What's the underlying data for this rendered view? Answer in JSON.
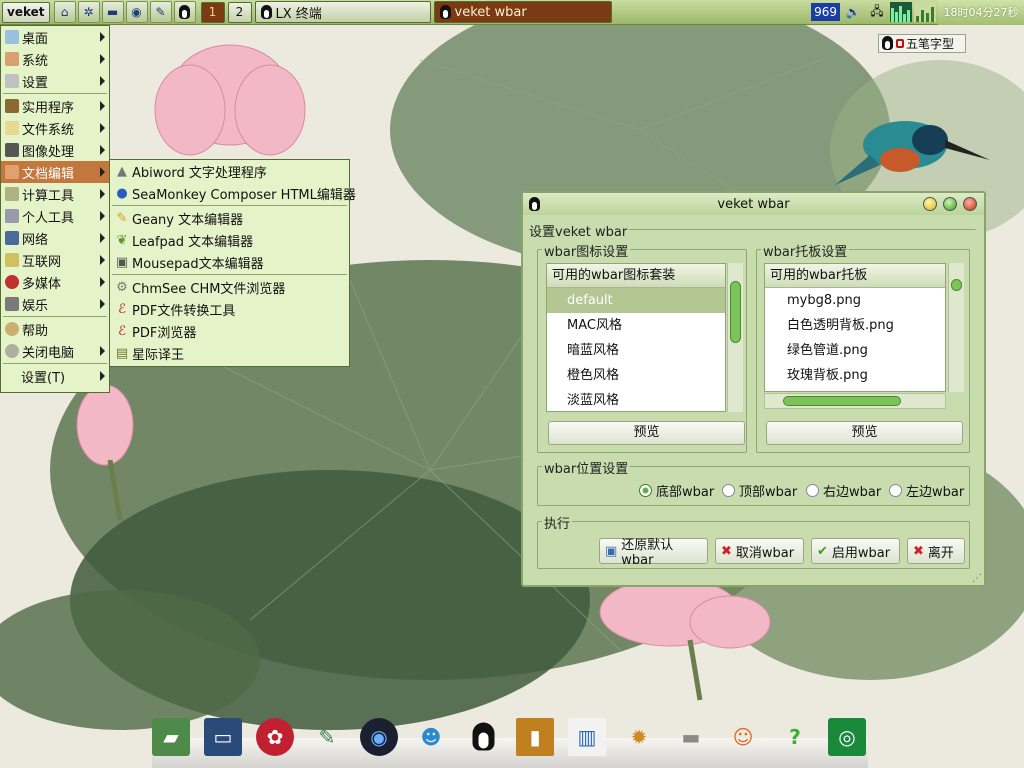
{
  "taskbar": {
    "start_label": "veket",
    "quicklaunch_icons": [
      "home-icon",
      "settings-icon",
      "terminal-icon",
      "browser-icon",
      "tools-icon",
      "qq-icon"
    ],
    "desktops": [
      "1",
      "2"
    ],
    "tasks": [
      {
        "label": "LX 终端",
        "active": false
      },
      {
        "label": "veket wbar",
        "active": true
      }
    ],
    "tray_number": "969",
    "clock": "18时04分27秒"
  },
  "ime": {
    "label": "五笔字型"
  },
  "main_menu": {
    "items": [
      {
        "label": "桌面",
        "icon": "desktop-icon",
        "submenu": true
      },
      {
        "label": "系统",
        "icon": "system-icon",
        "submenu": true
      },
      {
        "label": "设置",
        "icon": "settings-icon",
        "submenu": true
      },
      {
        "label": "实用程序",
        "icon": "utilities-icon",
        "submenu": true
      },
      {
        "label": "文件系统",
        "icon": "filesystem-icon",
        "submenu": true
      },
      {
        "label": "图像处理",
        "icon": "graphics-icon",
        "submenu": true
      },
      {
        "label": "文档编辑",
        "icon": "document-icon",
        "submenu": true,
        "highlighted": true
      },
      {
        "label": "计算工具",
        "icon": "calculator-icon",
        "submenu": true
      },
      {
        "label": "个人工具",
        "icon": "personal-icon",
        "submenu": true
      },
      {
        "label": "网络",
        "icon": "network-icon",
        "submenu": true
      },
      {
        "label": "互联网",
        "icon": "internet-icon",
        "submenu": true
      },
      {
        "label": "多媒体",
        "icon": "multimedia-icon",
        "submenu": true
      },
      {
        "label": "娱乐",
        "icon": "games-icon",
        "submenu": true
      },
      {
        "label": "帮助",
        "icon": "help-icon",
        "submenu": false
      },
      {
        "label": "关闭电脑",
        "icon": "shutdown-icon",
        "submenu": true
      },
      {
        "label": "设置(T)",
        "icon": "",
        "submenu": true
      }
    ]
  },
  "sub_menu": {
    "items": [
      {
        "label": "Abiword 文字处理程序",
        "icon": "abiword-icon"
      },
      {
        "label": "SeaMonkey Composer HTML编辑器",
        "icon": "seamonkey-icon"
      },
      {
        "label": "Geany 文本编辑器",
        "icon": "geany-icon"
      },
      {
        "label": "Leafpad 文本编辑器",
        "icon": "leafpad-icon"
      },
      {
        "label": "Mousepad文本编辑器",
        "icon": "mousepad-icon"
      },
      {
        "label": "ChmSee CHM文件浏览器",
        "icon": "chmsee-icon"
      },
      {
        "label": "PDF文件转换工具",
        "icon": "pdf-icon"
      },
      {
        "label": "PDF浏览器",
        "icon": "pdf-icon"
      },
      {
        "label": "星际译王",
        "icon": "stardict-icon"
      }
    ]
  },
  "dialog": {
    "title": "veket wbar",
    "group_title": "设置veket wbar",
    "icon_settings": {
      "legend": "wbar图标设置",
      "list_header": "可用的wbar图标套装",
      "items": [
        "default",
        "MAC风格",
        "暗蓝风格",
        "橙色风格",
        "淡蓝风格"
      ],
      "selected": "default",
      "preview_label": "预览"
    },
    "tray_settings": {
      "legend": "wbar托板设置",
      "list_header": "可用的wbar托板",
      "items": [
        "mybg8.png",
        "白色透明背板.png",
        "绿色管道.png",
        "玫瑰背板.png"
      ],
      "preview_label": "预览"
    },
    "position": {
      "legend": "wbar位置设置",
      "options": [
        "底部wbar",
        "顶部wbar",
        "右边wbar",
        "左边wbar"
      ],
      "selected": "底部wbar"
    },
    "actions": {
      "legend": "执行",
      "restore_label": "还原默认wbar",
      "cancel_label": "取消wbar",
      "enable_label": "启用wbar",
      "exit_label": "离开"
    }
  },
  "dock": {
    "icons": [
      "folder-icon",
      "monitor-icon",
      "pet-icon",
      "notepad-icon",
      "media-player-icon",
      "chat-icon",
      "qq-icon",
      "book-icon",
      "chart-icon",
      "paint-icon",
      "usb-icon",
      "mascot-icon",
      "green-app-icon",
      "camera-icon"
    ]
  },
  "colors": {
    "menu_bg": "#e5f3c8",
    "menu_highlight": "#c1773e",
    "dialog_bg": "#c8dcae",
    "taskbar_active": "#7a3b12"
  }
}
